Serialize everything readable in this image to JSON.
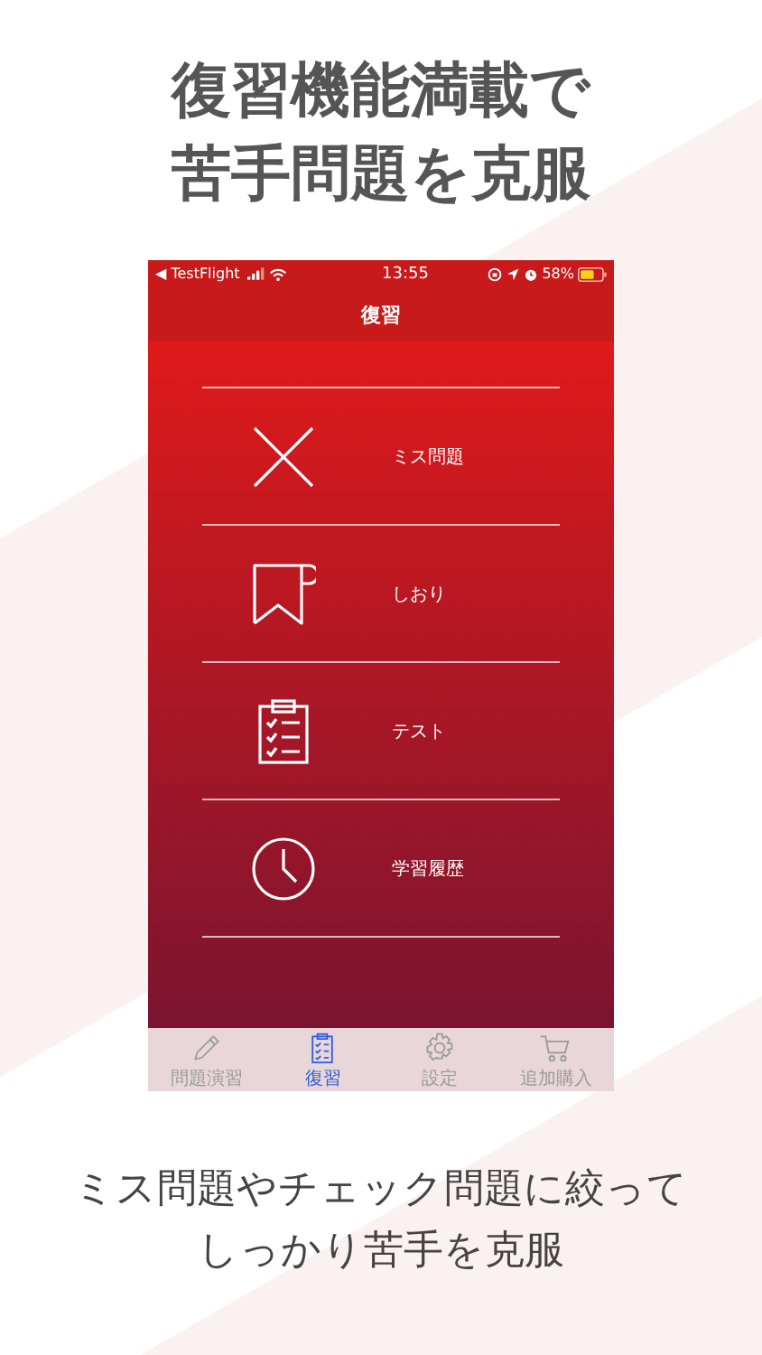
{
  "headline": [
    "復習機能満載で",
    "苦手問題を克服"
  ],
  "status_bar": {
    "back_app": "◀ TestFlight",
    "time": "13:55",
    "battery": "58%"
  },
  "nav_title": "復習",
  "menu": [
    {
      "label": "ミス問題"
    },
    {
      "label": "しおり"
    },
    {
      "label": "テスト"
    },
    {
      "label": "学習履歴"
    }
  ],
  "tabs": [
    {
      "label": "問題演習",
      "selected": false
    },
    {
      "label": "復習",
      "selected": true
    },
    {
      "label": "設定",
      "selected": false
    },
    {
      "label": "追加購入",
      "selected": false
    }
  ],
  "caption": [
    "ミス問題やチェック問題に絞って",
    "しっかり苦手を克服"
  ]
}
